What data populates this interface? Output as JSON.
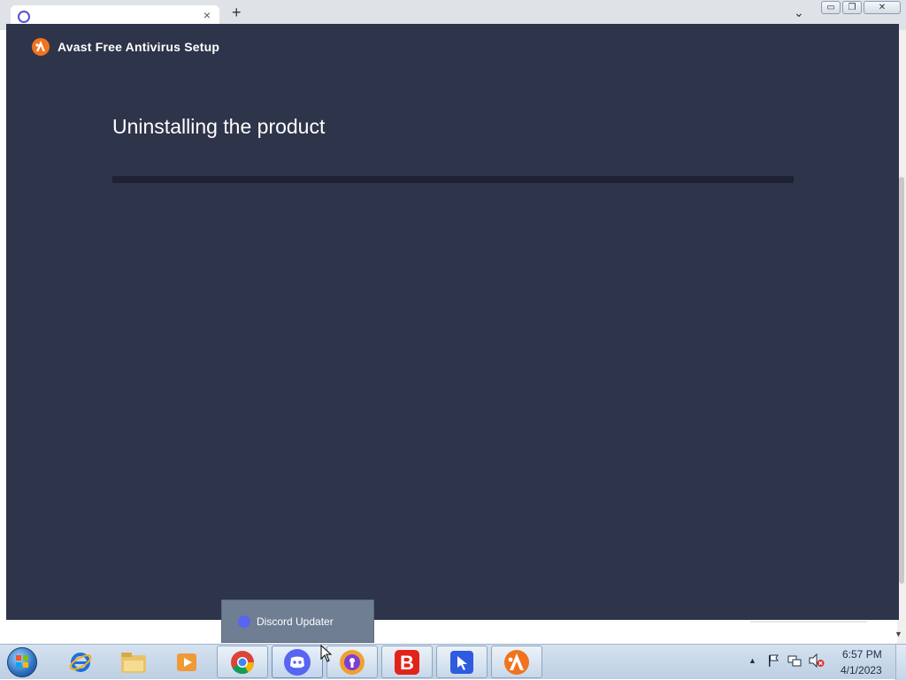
{
  "background_browser": {
    "tab_close": "×",
    "new_tab": "+",
    "tab_list": "⌄",
    "minimize": "▭",
    "restore": "❐",
    "close": "✕"
  },
  "avast_window": {
    "title": "Avast Free Antivirus Setup",
    "heading": "Uninstalling the product",
    "progress_fraction": 0.0,
    "accent_color": "#f0731f",
    "background_color": "#2e3449"
  },
  "taskbar": {
    "thumbnail_label": "Discord Updater",
    "tray_expand": "▲",
    "clock_time": "6:57 PM",
    "clock_date": "4/1/2023",
    "apps": [
      {
        "name": "internet-explorer-icon"
      },
      {
        "name": "file-explorer-icon"
      },
      {
        "name": "media-player-icon"
      },
      {
        "name": "chrome-icon"
      },
      {
        "name": "discord-icon"
      },
      {
        "name": "avast-secure-browser-icon"
      },
      {
        "name": "bitdefender-icon"
      },
      {
        "name": "blue-cursor-app-icon"
      },
      {
        "name": "avast-icon"
      }
    ]
  }
}
